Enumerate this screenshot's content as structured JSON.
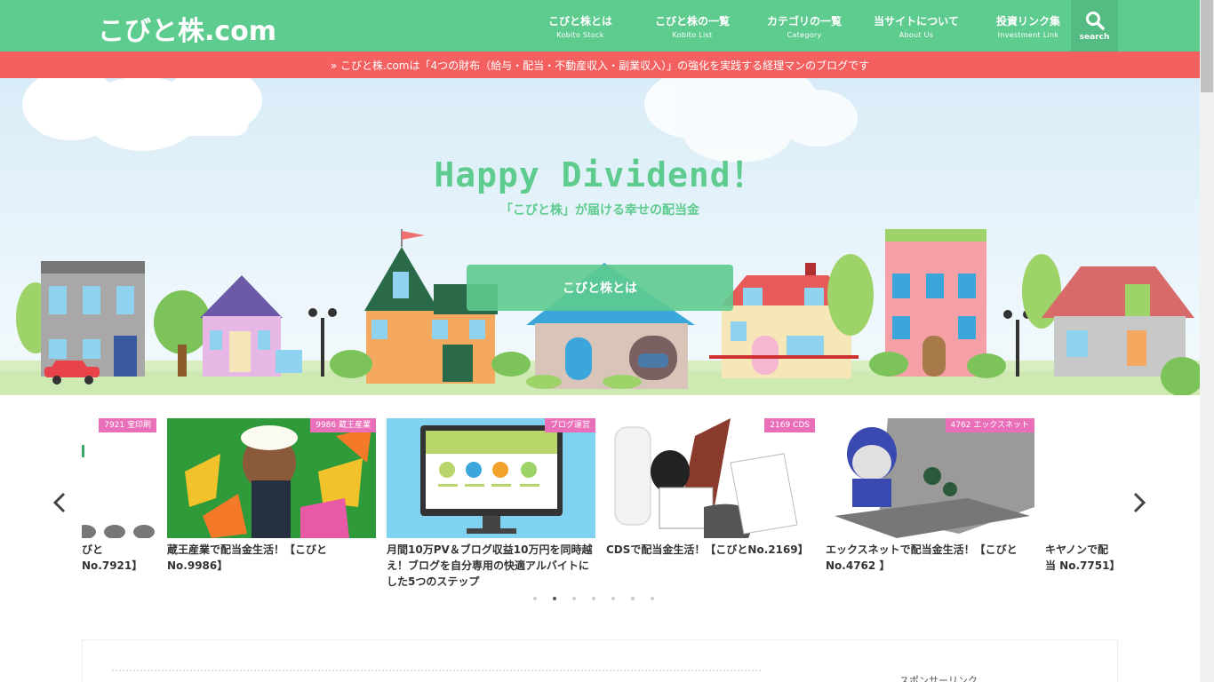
{
  "header": {
    "logo": "こびと株.com",
    "nav": [
      {
        "jp": "こびと株とは",
        "en": "Kobito Stock"
      },
      {
        "jp": "こびと株の一覧",
        "en": "Kobito List"
      },
      {
        "jp": "カテゴリの一覧",
        "en": "Category"
      },
      {
        "jp": "当サイトについて",
        "en": "About Us"
      },
      {
        "jp": "投資リンク集",
        "en": "Investment Link"
      }
    ],
    "search_label": "search"
  },
  "notice": {
    "text": "» こびと株.comは「4つの財布（給与・配当・不動産収入・副業収入）」の強化を実践する経理マンのブログです"
  },
  "hero": {
    "title": "Happy Dividend！",
    "subtitle": "「こびと株」が届ける幸せの配当金",
    "button": "こびと株とは"
  },
  "slider": {
    "prev": "‹",
    "next": "›",
    "cards": [
      {
        "tag": "7921 宝印刷",
        "title": "びとNo.7921】"
      },
      {
        "tag": "9986 蔵王産業",
        "title": "蔵王産業で配当金生活！【こびと No.9986】"
      },
      {
        "tag": "ブログ運営",
        "title": "月間10万PV＆ブログ収益10万円を同時越え！ブログを自分専用の快適アルバイトにした5つのステップ"
      },
      {
        "tag": "2169 CDS",
        "title": "CDSで配当金生活！【こびとNo.2169】"
      },
      {
        "tag": "4762 エックスネット",
        "title": "エックスネットで配当金生活！【こびと No.4762 】"
      },
      {
        "tag": "",
        "title": "キヤノンで配当 No.7751】"
      }
    ],
    "dots": 7,
    "active_dot": 1
  },
  "sidebar": {
    "sponsor": "スポンサーリンク"
  },
  "colors": {
    "brand": "#5ecb8f",
    "notice": "#f4605f",
    "tag": "#ea6fb9"
  }
}
